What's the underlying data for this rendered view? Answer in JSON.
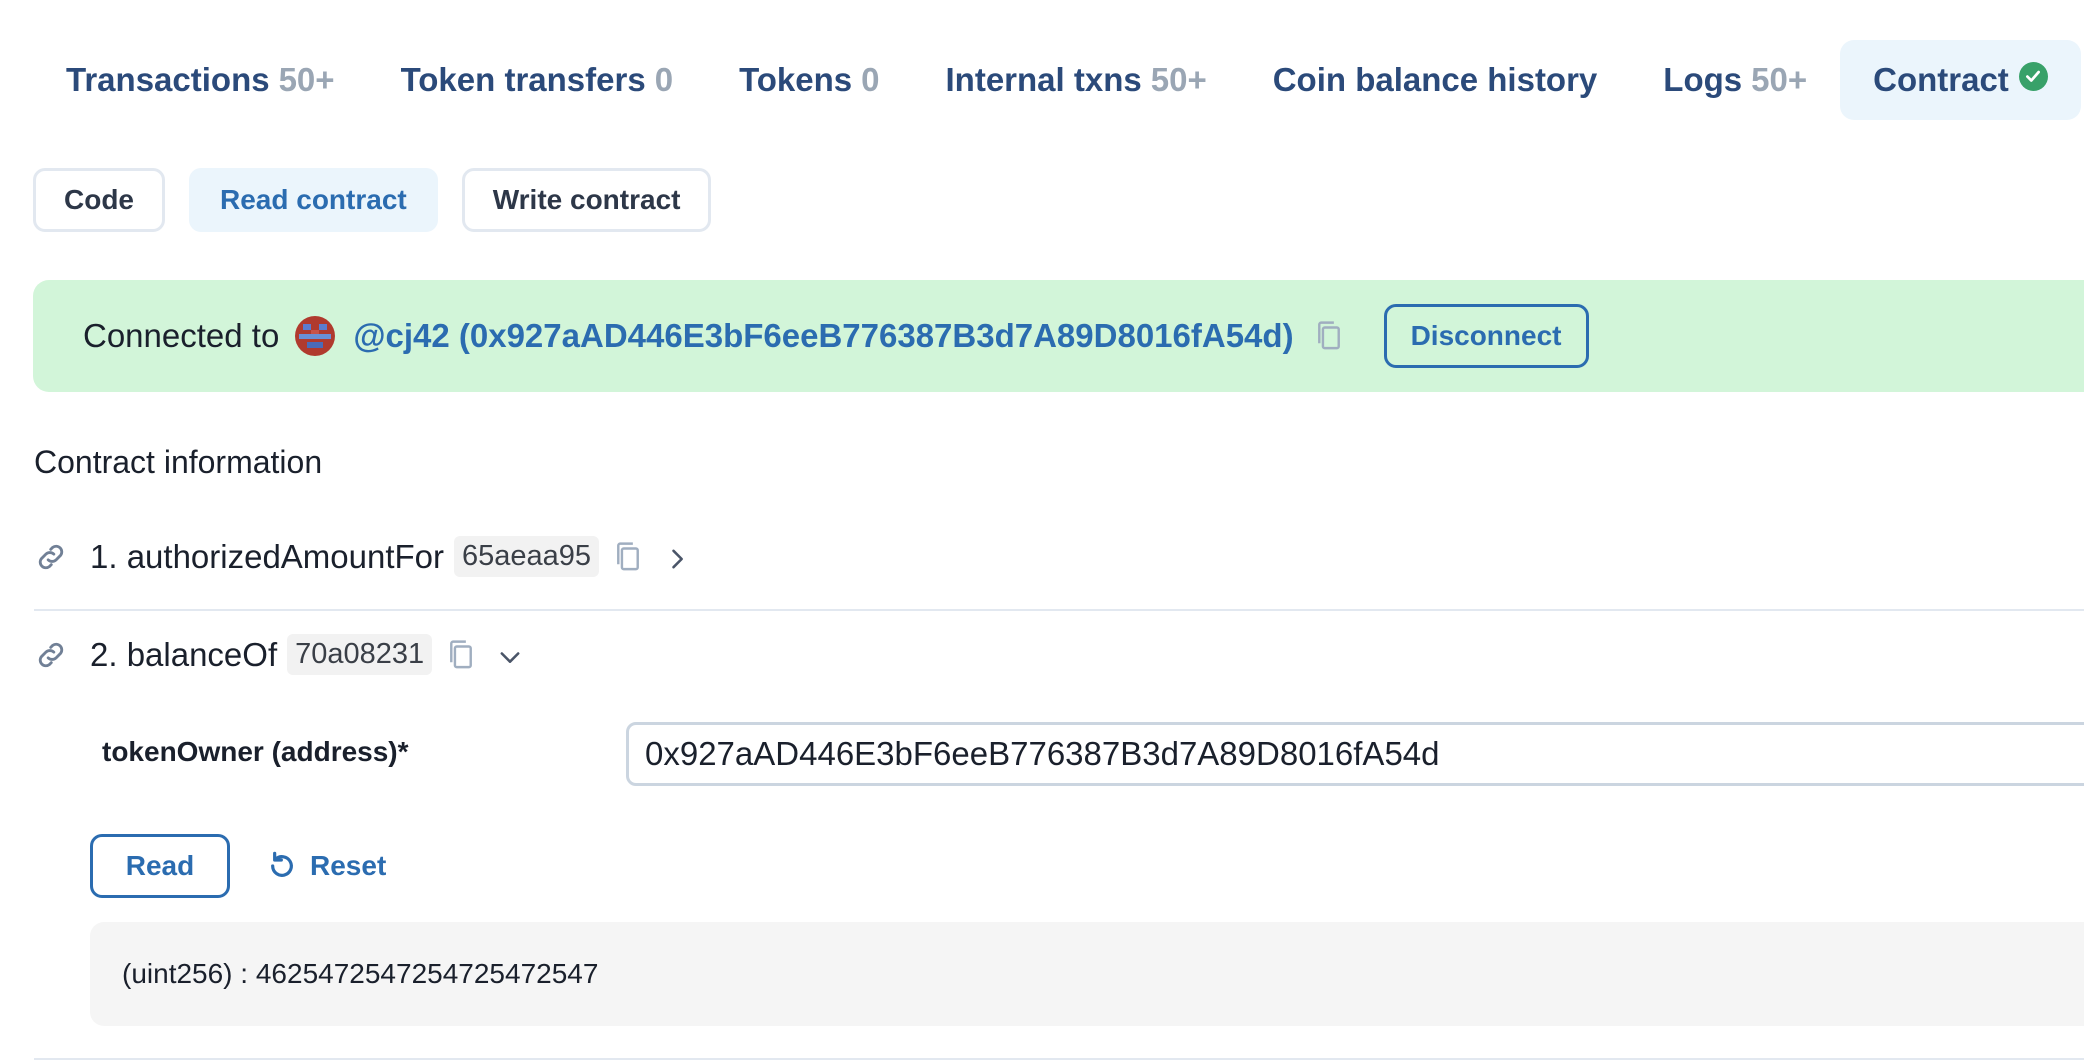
{
  "tabs": [
    {
      "label": "Transactions",
      "count": "50+"
    },
    {
      "label": "Token transfers",
      "count": "0"
    },
    {
      "label": "Tokens",
      "count": "0"
    },
    {
      "label": "Internal txns",
      "count": "50+"
    },
    {
      "label": "Coin balance history",
      "count": ""
    },
    {
      "label": "Logs",
      "count": "50+"
    },
    {
      "label": "Contract",
      "count": ""
    }
  ],
  "subtabs": {
    "code": "Code",
    "read": "Read contract",
    "write": "Write contract"
  },
  "banner": {
    "prefix": "Connected to",
    "wallet": "@cj42 (0x927aAD446E3bF6eeB776387B3d7A89D8016fA54d)",
    "disconnect": "Disconnect"
  },
  "section_title": "Contract information",
  "methods": [
    {
      "name": "1. authorizedAmountFor",
      "selector": "65aeaa95"
    },
    {
      "name": "2. balanceOf",
      "selector": "70a08231"
    }
  ],
  "form": {
    "label": "tokenOwner (address)*",
    "value": "0x927aAD446E3bF6eeB776387B3d7A89D8016fA54d",
    "read": "Read",
    "reset": "Reset"
  },
  "result": "(uint256) : 4625472547254725472547",
  "colors": {
    "accent": "#2b6cb0",
    "success": "#38a169",
    "banner_bg": "#d2f5d9"
  }
}
